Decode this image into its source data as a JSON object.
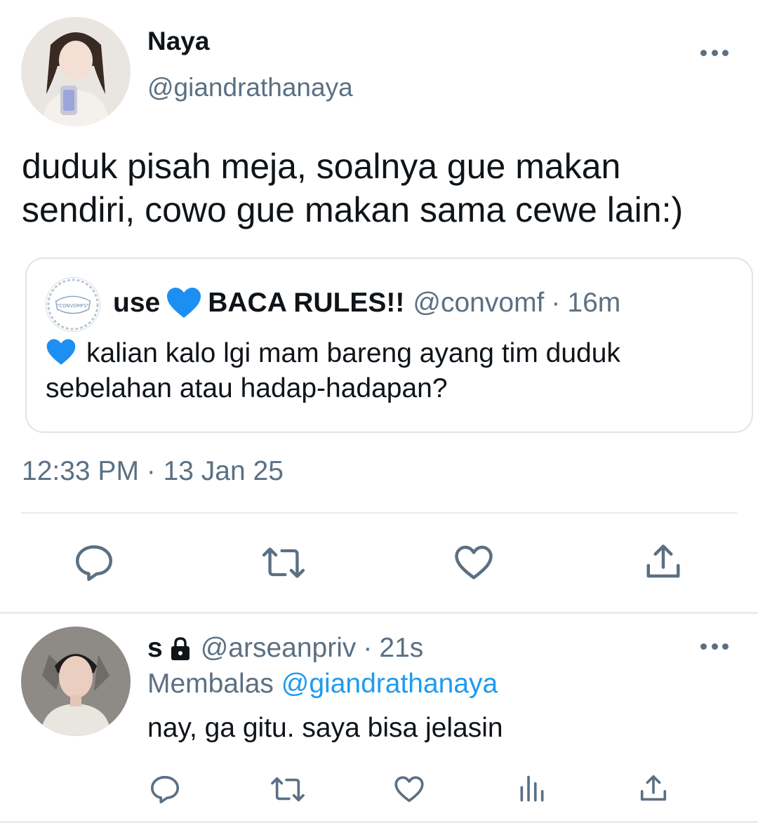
{
  "main_tweet": {
    "author_name": "Naya",
    "author_handle": "@giandrathanaya",
    "text": "duduk pisah meja, soalnya gue makan\nsendiri, cowo gue makan sama cewe lain:)",
    "quote": {
      "name_prefix": "use",
      "name_suffix": "BACA RULES!!",
      "handle": "@convomf",
      "separator": "·",
      "time": "16m",
      "text": "kalian kalo lgi mam bareng ayang tim duduk sebelahan atau hadap-hadapan?",
      "emoji": "blue-heart"
    },
    "timestamp": "12:33 PM · 13 Jan 25"
  },
  "reply_tweet": {
    "author_name": "s",
    "author_handle": "@arseanpriv",
    "separator": "·",
    "time": "21s",
    "replying_prefix": "Membalas",
    "replying_to": "@giandrathanaya",
    "text": "nay, ga gitu. saya bisa jelasin"
  },
  "icons": {
    "more": "more-horizontal-icon",
    "reply": "reply-bubble-icon",
    "retweet": "retweet-icon",
    "like": "heart-outline-icon",
    "share": "share-upload-icon",
    "stats": "stats-bars-icon",
    "lock": "lock-icon",
    "heart_emoji": "blue-heart-emoji"
  },
  "colors": {
    "text_primary": "#0f1419",
    "text_secondary": "#5b7083",
    "link": "#1d9bf0",
    "divider": "#e6ecf0",
    "blue_heart": "#1d8ff2"
  }
}
